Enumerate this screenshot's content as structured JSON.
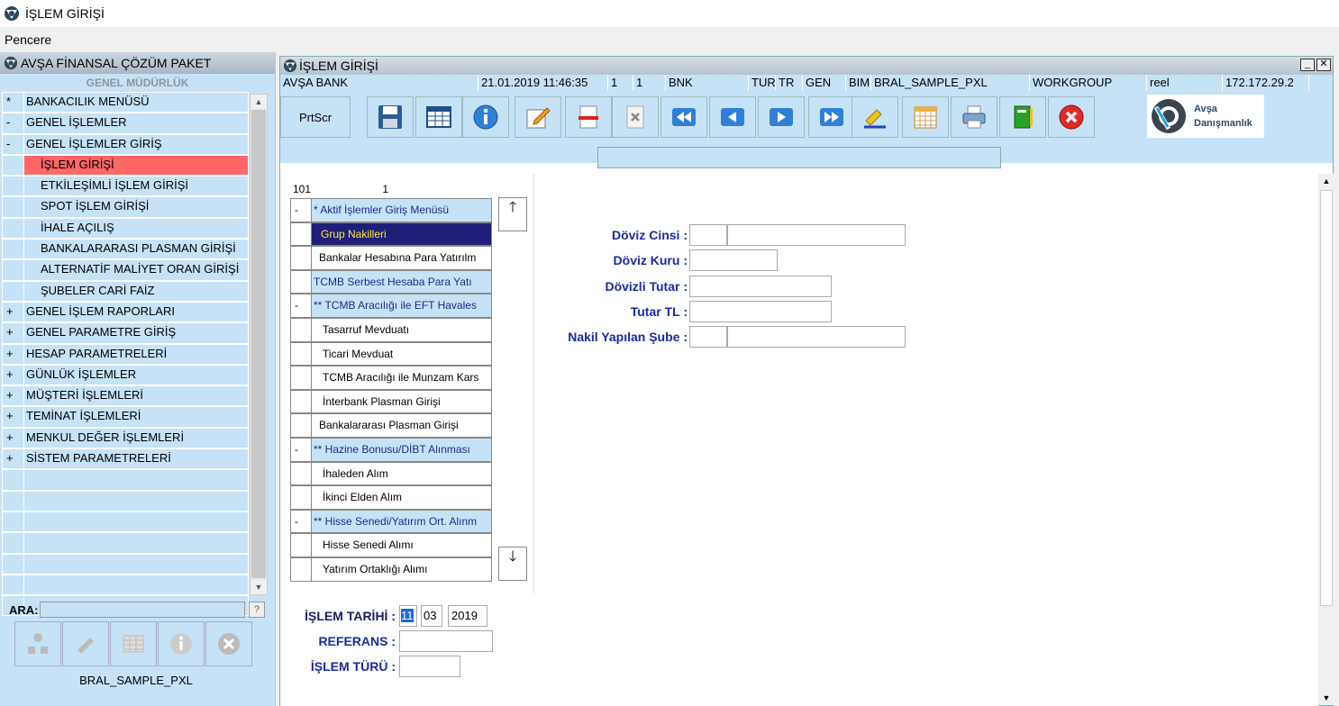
{
  "window": {
    "title": "İŞLEM GİRİŞİ"
  },
  "menubar": {
    "pencere": "Pencere"
  },
  "left": {
    "header": "AVŞA FİNANSAL ÇÖZÜM PAKET",
    "sub": "GENEL MÜDÜRLÜK",
    "tree": [
      {
        "mark": "*",
        "label": "BANKACILIK MENÜSÜ",
        "indent": false,
        "selected": false
      },
      {
        "mark": "-",
        "label": "GENEL İŞLEMLER",
        "indent": false,
        "selected": false
      },
      {
        "mark": "-",
        "label": "GENEL İŞLEMLER GİRİŞ",
        "indent": false,
        "selected": false
      },
      {
        "mark": "",
        "label": "İŞLEM GİRİŞİ",
        "indent": true,
        "selected": true
      },
      {
        "mark": "",
        "label": "ETKİLEŞİMLİ İŞLEM GİRİŞİ",
        "indent": true,
        "selected": false
      },
      {
        "mark": "",
        "label": "SPOT İŞLEM GİRİŞİ",
        "indent": true,
        "selected": false
      },
      {
        "mark": "",
        "label": "İHALE AÇILIŞ",
        "indent": true,
        "selected": false
      },
      {
        "mark": "",
        "label": "BANKALARARASI PLASMAN GİRİŞİ",
        "indent": true,
        "selected": false
      },
      {
        "mark": "",
        "label": "ALTERNATİF MALİYET ORAN GİRİŞİ",
        "indent": true,
        "selected": false
      },
      {
        "mark": "",
        "label": "ŞUBELER CARİ FAİZ",
        "indent": true,
        "selected": false
      },
      {
        "mark": "+",
        "label": "GENEL İŞLEM RAPORLARI",
        "indent": false,
        "selected": false
      },
      {
        "mark": "+",
        "label": "GENEL PARAMETRE GİRİŞ",
        "indent": false,
        "selected": false
      },
      {
        "mark": "+",
        "label": "HESAP PARAMETRELERİ",
        "indent": false,
        "selected": false
      },
      {
        "mark": "+",
        "label": "GÜNLÜK İŞLEMLER",
        "indent": false,
        "selected": false
      },
      {
        "mark": "+",
        "label": "MÜŞTERİ İŞLEMLERİ",
        "indent": false,
        "selected": false
      },
      {
        "mark": "+",
        "label": "TEMİNAT İŞLEMLERİ",
        "indent": false,
        "selected": false
      },
      {
        "mark": "+",
        "label": "MENKUL DEĞER İŞLEMLERİ",
        "indent": false,
        "selected": false
      },
      {
        "mark": "+",
        "label": "SİSTEM PARAMETRELERİ",
        "indent": false,
        "selected": false
      },
      {
        "mark": "",
        "label": "",
        "indent": false,
        "selected": false
      },
      {
        "mark": "",
        "label": "",
        "indent": false,
        "selected": false
      },
      {
        "mark": "",
        "label": "",
        "indent": false,
        "selected": false
      },
      {
        "mark": "",
        "label": "",
        "indent": false,
        "selected": false
      },
      {
        "mark": "",
        "label": "",
        "indent": false,
        "selected": false
      },
      {
        "mark": "",
        "label": "",
        "indent": false,
        "selected": false
      },
      {
        "mark": "",
        "label": "",
        "indent": false,
        "selected": false
      }
    ],
    "ara_label": "ARA:",
    "ara_value": "",
    "help": "?",
    "footer": "BRAL_SAMPLE_PXL"
  },
  "right": {
    "title": "İŞLEM GİRİŞİ",
    "status": [
      "AVŞA BANK",
      "21.01.2019 11:46:35",
      "1",
      "1",
      "BNK",
      "TUR",
      "TR",
      "GEN",
      "BIM",
      "BRAL_SAMPLE_PXL",
      "WORKGROUP",
      "reel",
      "172.172.29.2"
    ],
    "prtscr": "PrtScr",
    "logo": {
      "line1": "Avşa",
      "line2": "Danışmanlık"
    },
    "list_head": {
      "left": "101",
      "right": "1"
    },
    "list": [
      {
        "mark": "-",
        "text": "* Aktif İşlemler Giriş Menüsü",
        "kind": "group"
      },
      {
        "mark": "",
        "text": "Grup Nakilleri",
        "kind": "sel"
      },
      {
        "mark": "",
        "text": "Bankalar Hesabına Para Yatırılm",
        "kind": "item"
      },
      {
        "mark": "",
        "text": "TCMB Serbest Hesaba Para Yatı",
        "kind": "group"
      },
      {
        "mark": "-",
        "text": "** TCMB Aracılığı ile EFT Havales",
        "kind": "group"
      },
      {
        "mark": "",
        "text": "Tasarruf Mevduatı",
        "kind": "sub"
      },
      {
        "mark": "",
        "text": "Ticari Mevduat",
        "kind": "sub"
      },
      {
        "mark": "",
        "text": "TCMB Aracılığı ile Munzam Kars",
        "kind": "sub"
      },
      {
        "mark": "",
        "text": "İnterbank Plasman Girişi",
        "kind": "sub"
      },
      {
        "mark": "",
        "text": "Bankalararası Plasman Girişi",
        "kind": "item"
      },
      {
        "mark": "-",
        "text": "** Hazine Bonusu/DİBT Alınması",
        "kind": "group"
      },
      {
        "mark": "",
        "text": "İhaleden Alım",
        "kind": "sub"
      },
      {
        "mark": "",
        "text": "İkinci Elden Alım",
        "kind": "sub"
      },
      {
        "mark": "-",
        "text": "** Hisse Senedi/Yatırım Ort. Alınm",
        "kind": "group"
      },
      {
        "mark": "",
        "text": "Hisse Senedi Alımı",
        "kind": "sub"
      },
      {
        "mark": "",
        "text": "Yatırım Ortaklığı Alımı",
        "kind": "sub"
      }
    ],
    "arrow_up": "🡑",
    "arrow_down": "🡓",
    "form": {
      "doviz_cinsi": "Döviz Cinsi :",
      "doviz_kuru": "Döviz Kuru :",
      "dovizli_tutar": "Dövizli Tutar :",
      "tutar_tl": "Tutar TL :",
      "nakil_sube": "Nakil Yapılan Şube :"
    },
    "bottom": {
      "islem_tarihi": "İŞLEM TARİHİ :",
      "day": "11",
      "month": "03",
      "year": "2019",
      "referans": "REFERANS :",
      "islem_turu": "İŞLEM TÜRÜ :"
    }
  },
  "colors": {
    "panel": "#c6e2f7",
    "selected": "#ff6666",
    "label_blue": "#1a2aa8",
    "list_sel_bg": "#1f1f7a",
    "list_sel_fg": "#ffeb3b"
  }
}
